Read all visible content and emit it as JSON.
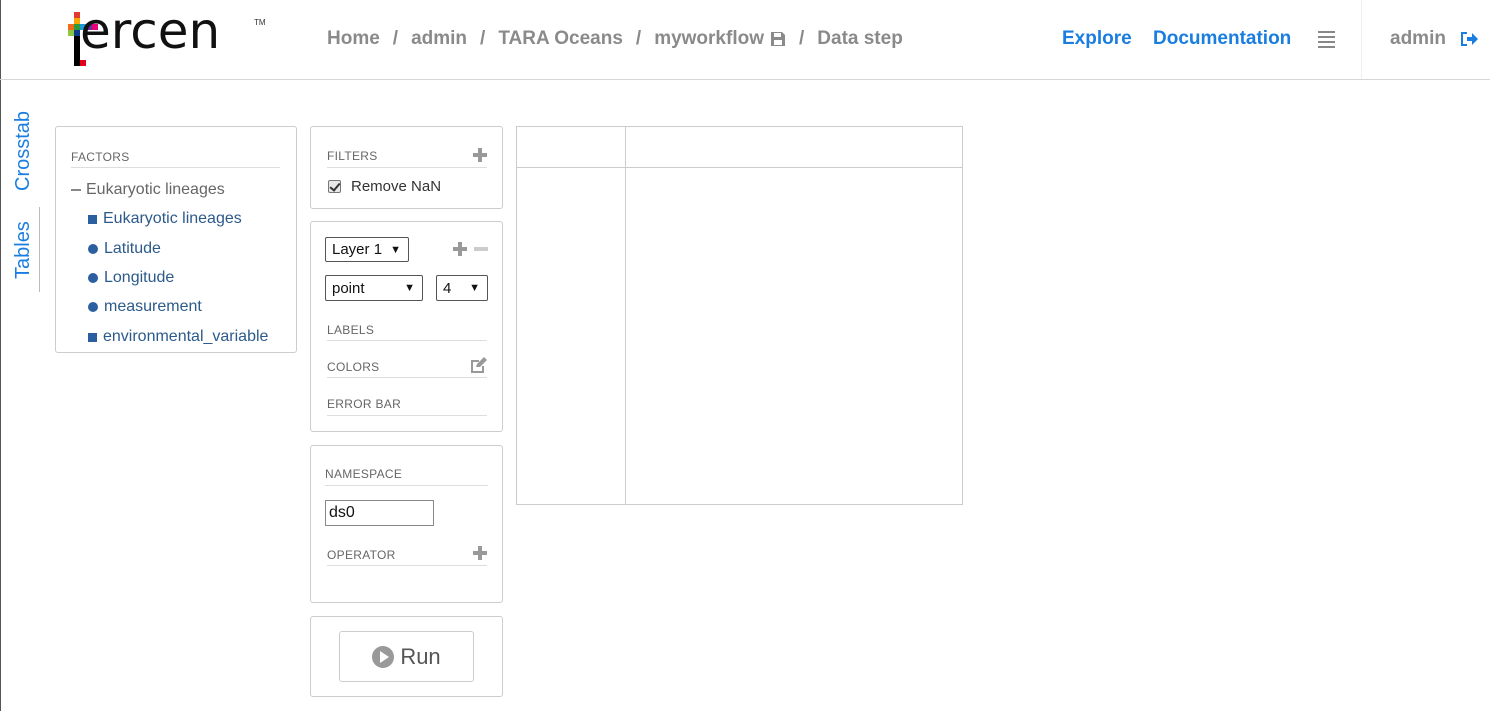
{
  "header": {
    "logo_text": "ercen",
    "logo_tm": "TM",
    "breadcrumb": [
      "Home",
      "admin",
      "TARA Oceans",
      "myworkflow",
      "Data step"
    ],
    "separator": "/",
    "nav": {
      "explore": "Explore",
      "documentation": "Documentation"
    },
    "user": "admin",
    "icons": {
      "save": "save-icon",
      "menu": "menu-icon",
      "logout": "logout-icon"
    }
  },
  "side_tabs": {
    "crosstab": "Crosstab",
    "tables": "Tables"
  },
  "factors": {
    "title": "FACTORS",
    "group": "Eukaryotic lineages",
    "items": [
      {
        "label": "Eukaryotic lineages",
        "shape": "square"
      },
      {
        "label": "Latitude",
        "shape": "circle"
      },
      {
        "label": "Longitude",
        "shape": "circle"
      },
      {
        "label": "measurement",
        "shape": "circle"
      },
      {
        "label": "environmental_variable",
        "shape": "square"
      }
    ]
  },
  "filters": {
    "title": "FILTERS",
    "remove_nan_label": "Remove NaN",
    "remove_nan_checked": true
  },
  "layer": {
    "layer_select": "Layer 1",
    "geom_select": "point",
    "size_select": "4",
    "labels_title": "LABELS",
    "colors_title": "COLORS",
    "error_bar_title": "ERROR BAR"
  },
  "namespace": {
    "title": "NAMESPACE",
    "value": "ds0",
    "operator_title": "OPERATOR"
  },
  "run": {
    "label": "Run"
  },
  "colors": {
    "link": "#1a7de0",
    "factor": "#2c5a8a",
    "muted": "#8a8a8a"
  }
}
